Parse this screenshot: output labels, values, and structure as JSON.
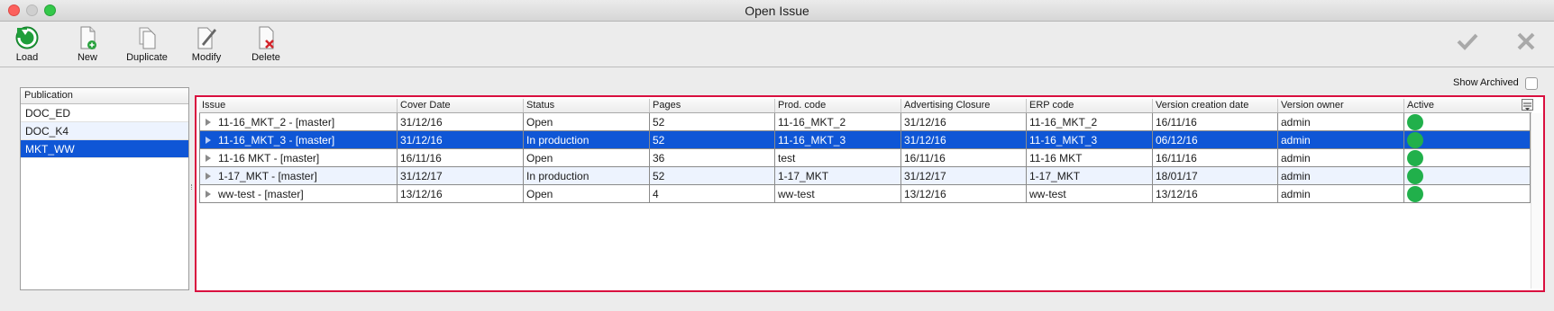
{
  "window": {
    "title": "Open Issue"
  },
  "toolbar": {
    "load_label": "Load",
    "new_label": "New",
    "duplicate_label": "Duplicate",
    "modify_label": "Modify",
    "delete_label": "Delete"
  },
  "show_archived": {
    "label": "Show Archived",
    "checked": false
  },
  "publication": {
    "header": "Publication",
    "items": [
      {
        "label": "DOC_ED"
      },
      {
        "label": "DOC_K4"
      },
      {
        "label": "MKT_WW",
        "selected": true
      }
    ]
  },
  "issues": {
    "columns": [
      "Issue",
      "Cover Date",
      "Status",
      "Pages",
      "Prod. code",
      "Advertising Closure",
      "ERP code",
      "Version creation date",
      "Version owner",
      "Active"
    ],
    "rows": [
      {
        "issue": "11-16_MKT_2 - [master]",
        "cover_date": "31/12/16",
        "status": "Open",
        "pages": "52",
        "prod_code": "11-16_MKT_2",
        "adv_closure": "31/12/16",
        "erp_code": "11-16_MKT_2",
        "version_date": "16/11/16",
        "owner": "admin",
        "active": true
      },
      {
        "issue": "11-16_MKT_3 - [master]",
        "cover_date": "31/12/16",
        "status": "In production",
        "pages": "52",
        "prod_code": "11-16_MKT_3",
        "adv_closure": "31/12/16",
        "erp_code": "11-16_MKT_3",
        "version_date": "06/12/16",
        "owner": "admin",
        "active": true,
        "selected": true
      },
      {
        "issue": "11-16 MKT - [master]",
        "cover_date": "16/11/16",
        "status": "Open",
        "pages": "36",
        "prod_code": "test",
        "adv_closure": "16/11/16",
        "erp_code": "11-16 MKT",
        "version_date": "16/11/16",
        "owner": "admin",
        "active": true
      },
      {
        "issue": "1-17_MKT - [master]",
        "cover_date": "31/12/17",
        "status": "In production",
        "pages": "52",
        "prod_code": "1-17_MKT",
        "adv_closure": "31/12/17",
        "erp_code": "1-17_MKT",
        "version_date": "18/01/17",
        "owner": "admin",
        "active": true
      },
      {
        "issue": "ww-test - [master]",
        "cover_date": "13/12/16",
        "status": "Open",
        "pages": "4",
        "prod_code": "ww-test",
        "adv_closure": "13/12/16",
        "erp_code": "ww-test",
        "version_date": "13/12/16",
        "owner": "admin",
        "active": true
      }
    ]
  },
  "colors": {
    "selection": "#0f56d6",
    "active_dot": "#21b04b",
    "highlight_border": "#d90f3f"
  }
}
